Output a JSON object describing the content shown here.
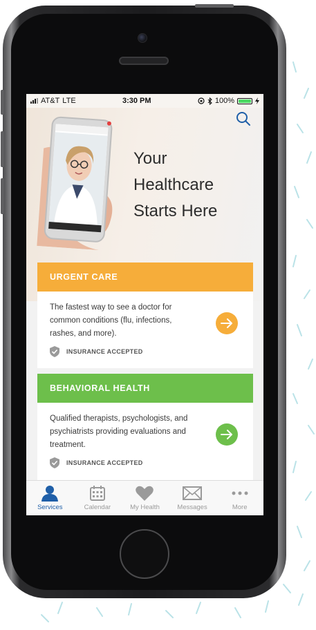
{
  "status_bar": {
    "carrier": "AT&T",
    "network": "LTE",
    "time": "3:30 PM",
    "battery_percent": "100%"
  },
  "hero": {
    "title": "Your\nHealthcare\nStarts Here",
    "search_icon": "search-icon"
  },
  "cards": [
    {
      "title": "URGENT CARE",
      "description": "The fastest way to see a doctor for common conditions (flu, infections, rashes, and more).",
      "badge": "INSURANCE ACCEPTED",
      "color": "#f6ad3a"
    },
    {
      "title": "BEHAVIORAL HEALTH",
      "description": "Qualified therapists, psychologists, and psychiatrists providing evaluations and treatment.",
      "badge": "INSURANCE ACCEPTED",
      "color": "#6dbf4b"
    }
  ],
  "tabs": [
    {
      "label": "Services",
      "icon": "person-icon",
      "active": true
    },
    {
      "label": "Calendar",
      "icon": "calendar-icon"
    },
    {
      "label": "My Health",
      "icon": "heart-icon"
    },
    {
      "label": "Messages",
      "icon": "envelope-icon"
    },
    {
      "label": "More",
      "icon": "more-dots-icon"
    }
  ],
  "colors": {
    "accent": "#1f5fa8",
    "urgent": "#f6ad3a",
    "behavioral": "#6dbf4b"
  }
}
